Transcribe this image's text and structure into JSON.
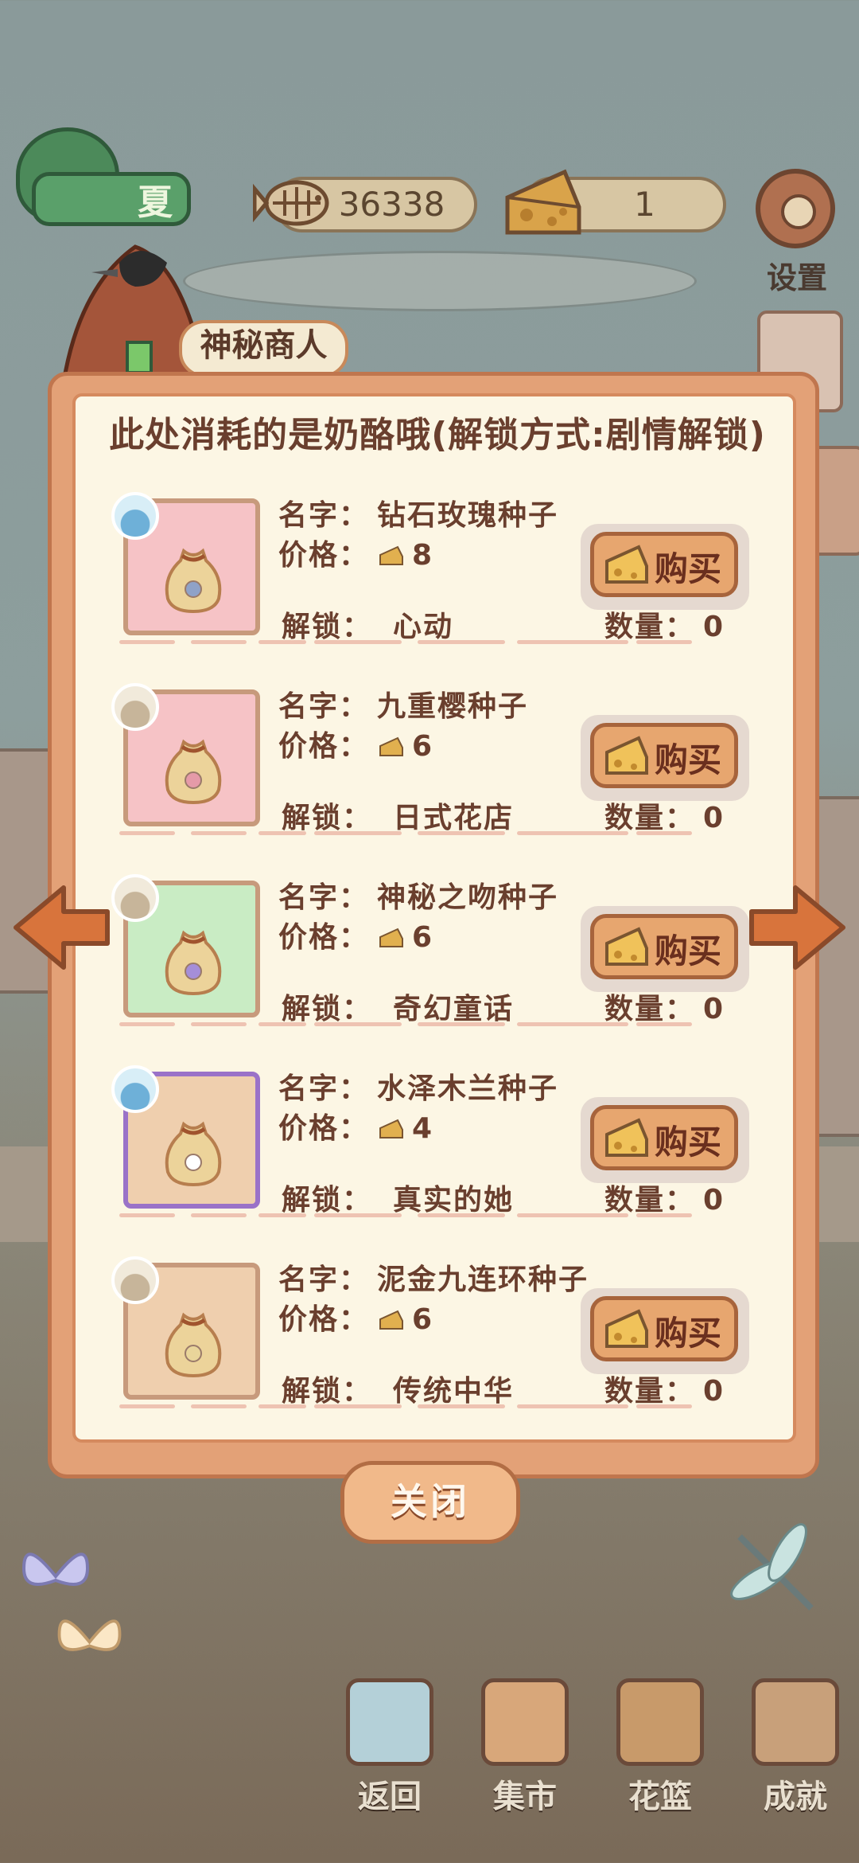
{
  "hud": {
    "season": "夏",
    "fish_count": "36338",
    "cheese_count": "1",
    "settings_label": "设置"
  },
  "merchant": {
    "name": "神秘商人"
  },
  "panel": {
    "header": "此处消耗的是奶酪哦(解锁方式:剧情解锁)",
    "name_label": "名字：",
    "price_label": "价格：",
    "unlock_label": "解锁：",
    "quantity_label": "数量：",
    "buy_label": "购买",
    "items": [
      {
        "name": "钻石玫瑰种子",
        "price": "8",
        "unlock": "心动",
        "quantity": "0",
        "bg": "#f6c3c6",
        "badge": "water",
        "frame": "#c79a7c",
        "flower": "#8fa2c8"
      },
      {
        "name": "九重樱种子",
        "price": "6",
        "unlock": "日式花店",
        "quantity": "0",
        "bg": "#f6c3c6",
        "badge": "soil",
        "frame": "#c79a7c",
        "flower": "#e59aa8"
      },
      {
        "name": "神秘之吻种子",
        "price": "6",
        "unlock": "奇幻童话",
        "quantity": "0",
        "bg": "#c9ecc4",
        "badge": "soil",
        "frame": "#c79a7c",
        "flower": "#a58ed8"
      },
      {
        "name": "水泽木兰种子",
        "price": "4",
        "unlock": "真实的她",
        "quantity": "0",
        "bg": "#efcfae",
        "badge": "water",
        "frame": "#9a72c8",
        "flower": "#ffffff"
      },
      {
        "name": "泥金九连环种子",
        "price": "6",
        "unlock": "传统中华",
        "quantity": "0",
        "bg": "#efcfae",
        "badge": "soil",
        "frame": "#c79a7c",
        "flower": "#e9d59a"
      }
    ]
  },
  "close_label": "关闭",
  "bottom_nav": [
    {
      "label": "返回"
    },
    {
      "label": "集市"
    },
    {
      "label": "花篮"
    },
    {
      "label": "成就"
    }
  ]
}
